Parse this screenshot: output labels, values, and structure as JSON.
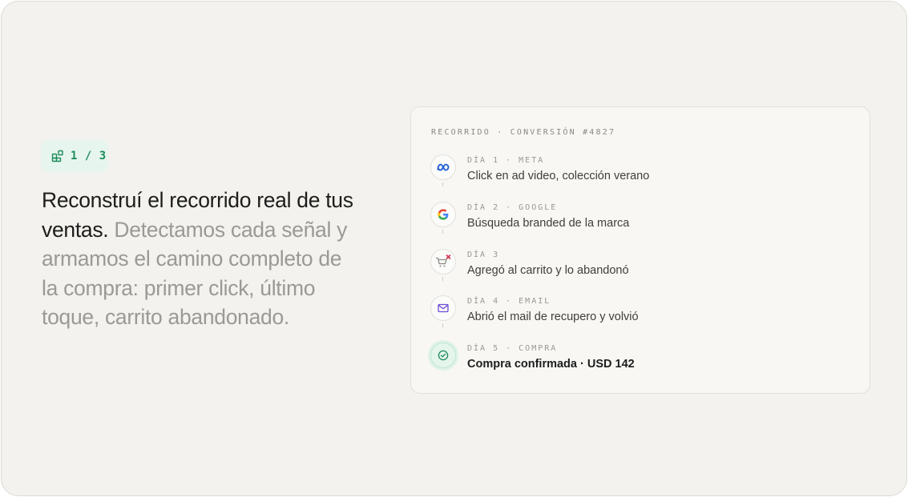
{
  "badge": {
    "text": "1 / 3",
    "icon": "blocks-icon",
    "color": "#1f8a5b"
  },
  "headline": {
    "strong": "Reconstruí el recorrido real de tus ventas.",
    "muted": "Detectamos cada señal y armamos el camino completo de la compra: primer click, último toque, carrito abandonado."
  },
  "journey": {
    "header": "RECORRIDO · CONVERSIÓN #4827",
    "steps": [
      {
        "label": "DÍA 1 · META",
        "text": "Click en ad video, colección verano",
        "icon": "meta-icon"
      },
      {
        "label": "DÍA 2 · GOOGLE",
        "text": "Búsqueda branded de la marca",
        "icon": "google-icon"
      },
      {
        "label": "DÍA 3",
        "text": "Agregó al carrito y lo abandonó",
        "icon": "cart-abandoned-icon"
      },
      {
        "label": "DÍA 4 · EMAIL",
        "text": "Abrió el mail de recupero y volvió",
        "icon": "mail-icon"
      },
      {
        "label": "DÍA 5 · COMPRA",
        "text": "Compra confirmada · USD 142",
        "icon": "check-circle-icon"
      }
    ]
  },
  "colors": {
    "accent": "#1f8a5b",
    "meta": "#1a5ad8",
    "mail": "#6b4bd6",
    "error": "#d2324d"
  }
}
